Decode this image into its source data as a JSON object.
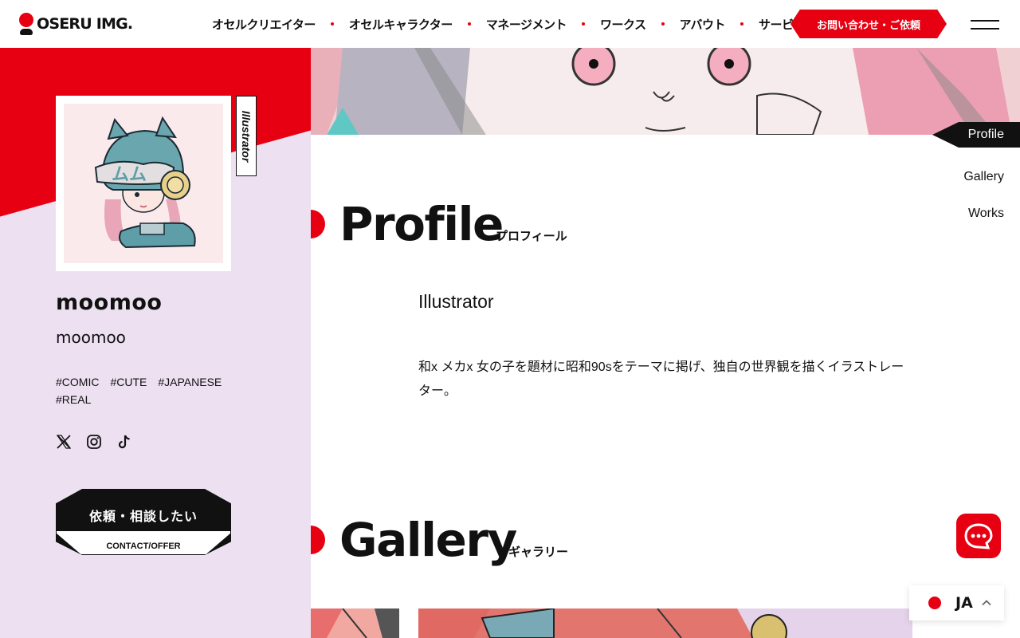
{
  "header": {
    "logo_text": "OSERU IMG.",
    "nav": [
      {
        "label": "オセルクリエイター"
      },
      {
        "label": "オセルキャラクター"
      },
      {
        "label": "マネージメント"
      },
      {
        "label": "ワークス"
      },
      {
        "label": "アバウト"
      },
      {
        "label": "サービス"
      }
    ],
    "contact_label": "お問い合わせ・ご依頼",
    "menu_icon": "hamburger-icon"
  },
  "sidebar": {
    "role_tag": "Illustrator",
    "name": "moomoo",
    "name_sub": "moomoo",
    "tags": [
      "#COMIC",
      "#CUTE",
      "#JAPANESE",
      "#REAL"
    ],
    "socials": [
      "x-icon",
      "instagram-icon",
      "tiktok-icon"
    ],
    "offer_main": "依頼・相談したい",
    "offer_sub": "CONTACT/OFFER"
  },
  "side_nav": {
    "items": [
      {
        "label": "Profile",
        "active": true
      },
      {
        "label": "Gallery",
        "active": false
      },
      {
        "label": "Works",
        "active": false
      }
    ]
  },
  "profile": {
    "title": "Profile",
    "title_ja": "プロフィール",
    "role": "Illustrator",
    "description": "和x メカx 女の子を題材に昭和90sをテーマに掲げ、独自の世界観を描くイラストレーター。"
  },
  "gallery": {
    "title": "Gallery",
    "title_ja": "ギャラリー"
  },
  "language": {
    "code": "JA"
  },
  "colors": {
    "accent": "#e60012",
    "sidebar_bg": "#ede1f1",
    "ink": "#111111"
  }
}
